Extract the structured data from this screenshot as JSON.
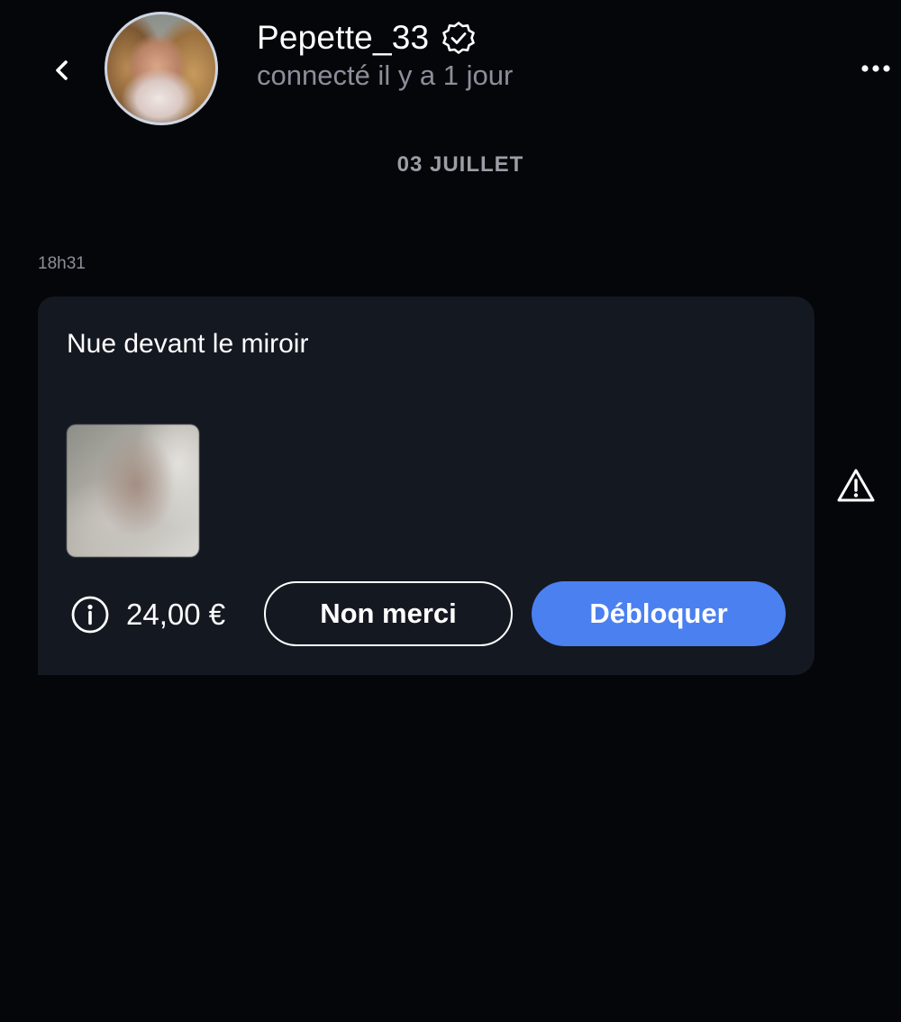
{
  "header": {
    "username": "Pepette_33",
    "status": "connecté il y a 1 jour",
    "back_icon": "chevron-left-icon",
    "verified_icon": "verified-badge-icon",
    "more_icon": "more-horizontal-icon"
  },
  "conversation": {
    "date_separator": "03 JUILLET",
    "message": {
      "time": "18h31",
      "title": "Nue devant le miroir",
      "price": "24,00 €",
      "decline_label": "Non merci",
      "unlock_label": "Débloquer",
      "info_icon": "info-icon",
      "report_icon": "warning-icon"
    }
  },
  "colors": {
    "background": "#05060a",
    "card": "#141821",
    "accent": "#4a80f0",
    "muted_text": "#8b8f99"
  }
}
